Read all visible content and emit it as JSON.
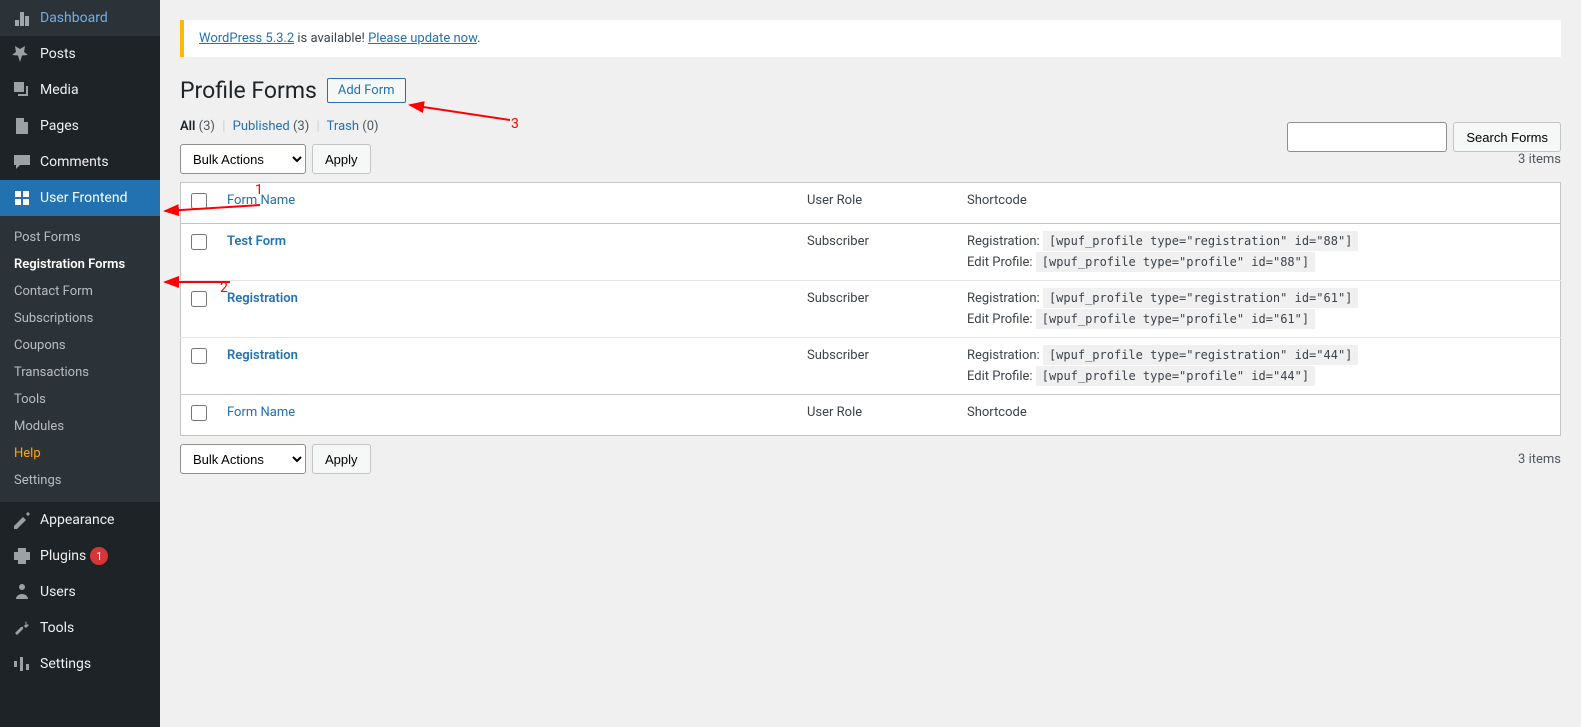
{
  "sidebar": {
    "items": [
      {
        "label": "Dashboard",
        "icon": "dashboard"
      },
      {
        "label": "Posts",
        "icon": "pin"
      },
      {
        "label": "Media",
        "icon": "media"
      },
      {
        "label": "Pages",
        "icon": "page"
      },
      {
        "label": "Comments",
        "icon": "comment"
      },
      {
        "label": "User Frontend",
        "icon": "frontend",
        "active": true
      },
      {
        "label": "Appearance",
        "icon": "appearance"
      },
      {
        "label": "Plugins",
        "icon": "plugin",
        "badge": "1"
      },
      {
        "label": "Users",
        "icon": "users"
      },
      {
        "label": "Tools",
        "icon": "tools"
      },
      {
        "label": "Settings",
        "icon": "settings"
      }
    ],
    "submenu": [
      {
        "label": "Post Forms"
      },
      {
        "label": "Registration Forms",
        "current": true
      },
      {
        "label": "Contact Form"
      },
      {
        "label": "Subscriptions"
      },
      {
        "label": "Coupons"
      },
      {
        "label": "Transactions"
      },
      {
        "label": "Tools"
      },
      {
        "label": "Modules"
      },
      {
        "label": "Help",
        "highlight": true
      },
      {
        "label": "Settings"
      }
    ]
  },
  "notice": {
    "prefix": "WordPress 5.3.2",
    "mid": " is available! ",
    "link": "Please update now",
    "suffix": "."
  },
  "page": {
    "title": "Profile Forms",
    "add_form": "Add Form"
  },
  "filters": {
    "all_label": "All",
    "all_count": "(3)",
    "pub_label": "Published",
    "pub_count": "(3)",
    "trash_label": "Trash",
    "trash_count": "(0)"
  },
  "bulk": {
    "select": "Bulk Actions",
    "apply": "Apply"
  },
  "search": {
    "button": "Search Forms"
  },
  "items_count": "3 items",
  "table": {
    "col_form": "Form Name",
    "col_role": "User Role",
    "col_shortcode": "Shortcode",
    "reg_label": "Registration:",
    "edit_label": "Edit Profile:",
    "rows": [
      {
        "name": "Test Form",
        "role": "Subscriber",
        "reg": "[wpuf_profile type=\"registration\" id=\"88\"]",
        "edit": "[wpuf_profile type=\"profile\" id=\"88\"]"
      },
      {
        "name": "Registration",
        "role": "Subscriber",
        "reg": "[wpuf_profile type=\"registration\" id=\"61\"]",
        "edit": "[wpuf_profile type=\"profile\" id=\"61\"]"
      },
      {
        "name": "Registration",
        "role": "Subscriber",
        "reg": "[wpuf_profile type=\"registration\" id=\"44\"]",
        "edit": "[wpuf_profile type=\"profile\" id=\"44\"]"
      }
    ]
  },
  "annotations": {
    "n1": "1",
    "n2": "2",
    "n3": "3"
  }
}
